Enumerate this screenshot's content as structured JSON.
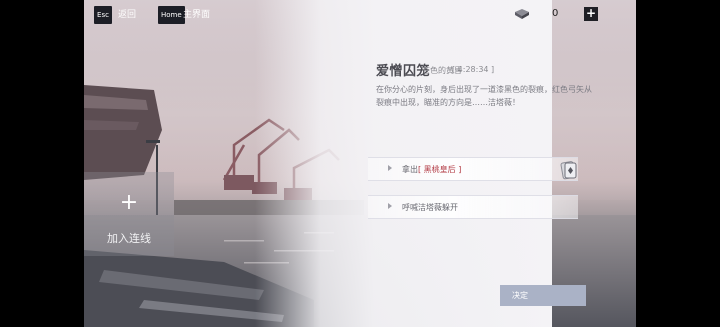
{
  "topbar": {
    "esc_key": "Esc",
    "back_label": "返回",
    "home_key": "Home",
    "home_label": "主界面"
  },
  "currency": {
    "icon": "gem-icon",
    "amount": "0",
    "add_label": "+"
  },
  "join": {
    "plus": "+",
    "label": "加入连线"
  },
  "event": {
    "title": "爱憎囚笼",
    "subtitle": "苍色的黄昏",
    "time": "[ 4:28:34 ]",
    "description": "在你分心的片刻，身后出现了一道漆黑色的裂痕，红色弓矢从裂痕中出现，瞄准的方向是……洁塔薇！"
  },
  "options": [
    {
      "prefix": "拿出",
      "highlight": "[ 黑桃皇后 ]",
      "icon": "card-icon"
    },
    {
      "prefix": "呼喊洁塔薇躲开",
      "highlight": ""
    }
  ],
  "confirm_label": "决定",
  "colors": {
    "accent": "#aab2c6",
    "highlight": "#b23a44",
    "hud": "#1c1e26"
  }
}
